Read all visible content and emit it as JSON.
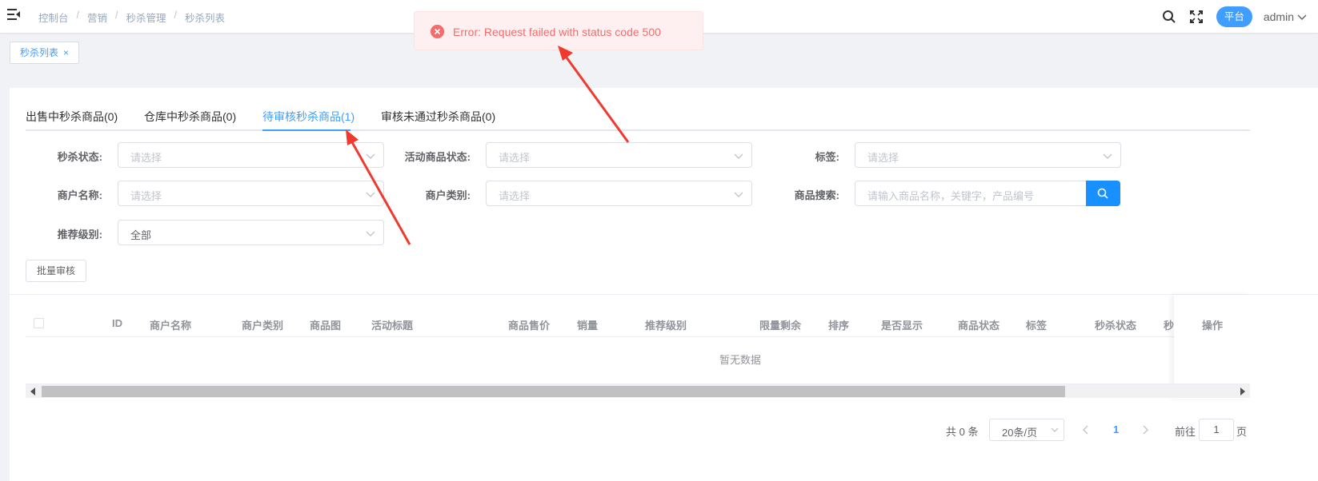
{
  "header": {
    "breadcrumb": [
      "控制台",
      "营销",
      "秒杀管理",
      "秒杀列表"
    ],
    "role_tag": "平台",
    "user": "admin"
  },
  "tagsview": {
    "label": "秒杀列表",
    "close": "×"
  },
  "tabs": [
    {
      "label": "出售中秒杀商品(0)"
    },
    {
      "label": "仓库中秒杀商品(0)"
    },
    {
      "label": "待审核秒杀商品(1)"
    },
    {
      "label": "审核未通过秒杀商品(0)"
    }
  ],
  "filters": {
    "seckill_status": {
      "label": "秒杀状态:",
      "placeholder": "请选择"
    },
    "activity_status": {
      "label": "活动商品状态:",
      "placeholder": "请选择"
    },
    "tag": {
      "label": "标签:",
      "placeholder": "请选择"
    },
    "merchant_name": {
      "label": "商户名称:",
      "placeholder": "请选择"
    },
    "merchant_type": {
      "label": "商户类别:",
      "placeholder": "请选择"
    },
    "product_search": {
      "label": "商品搜索:",
      "placeholder": "请输入商品名称，关键字，产品编号"
    },
    "recommend_level": {
      "label": "推荐级别:",
      "value": "全部"
    }
  },
  "batch_button": "批量审核",
  "table": {
    "columns": [
      "ID",
      "商户名称",
      "商户类别",
      "商品图",
      "活动标题",
      "商品售价",
      "销量",
      "推荐级别",
      "限量剩余",
      "排序",
      "是否显示",
      "商品状态",
      "标签",
      "秒杀状态",
      "秒",
      "操作"
    ],
    "empty_text": "暂无数据"
  },
  "pagination": {
    "total": "共 0 条",
    "page_size": "20条/页",
    "current_page": "1",
    "goto_prefix": "前往",
    "goto_value": "1",
    "goto_suffix": "页"
  },
  "toast": {
    "type": "error",
    "message": "Error: Request failed with status code 500"
  },
  "colors": {
    "accent": "#409eff",
    "error": "#f56c6c",
    "arrow": "#f03a2f"
  }
}
